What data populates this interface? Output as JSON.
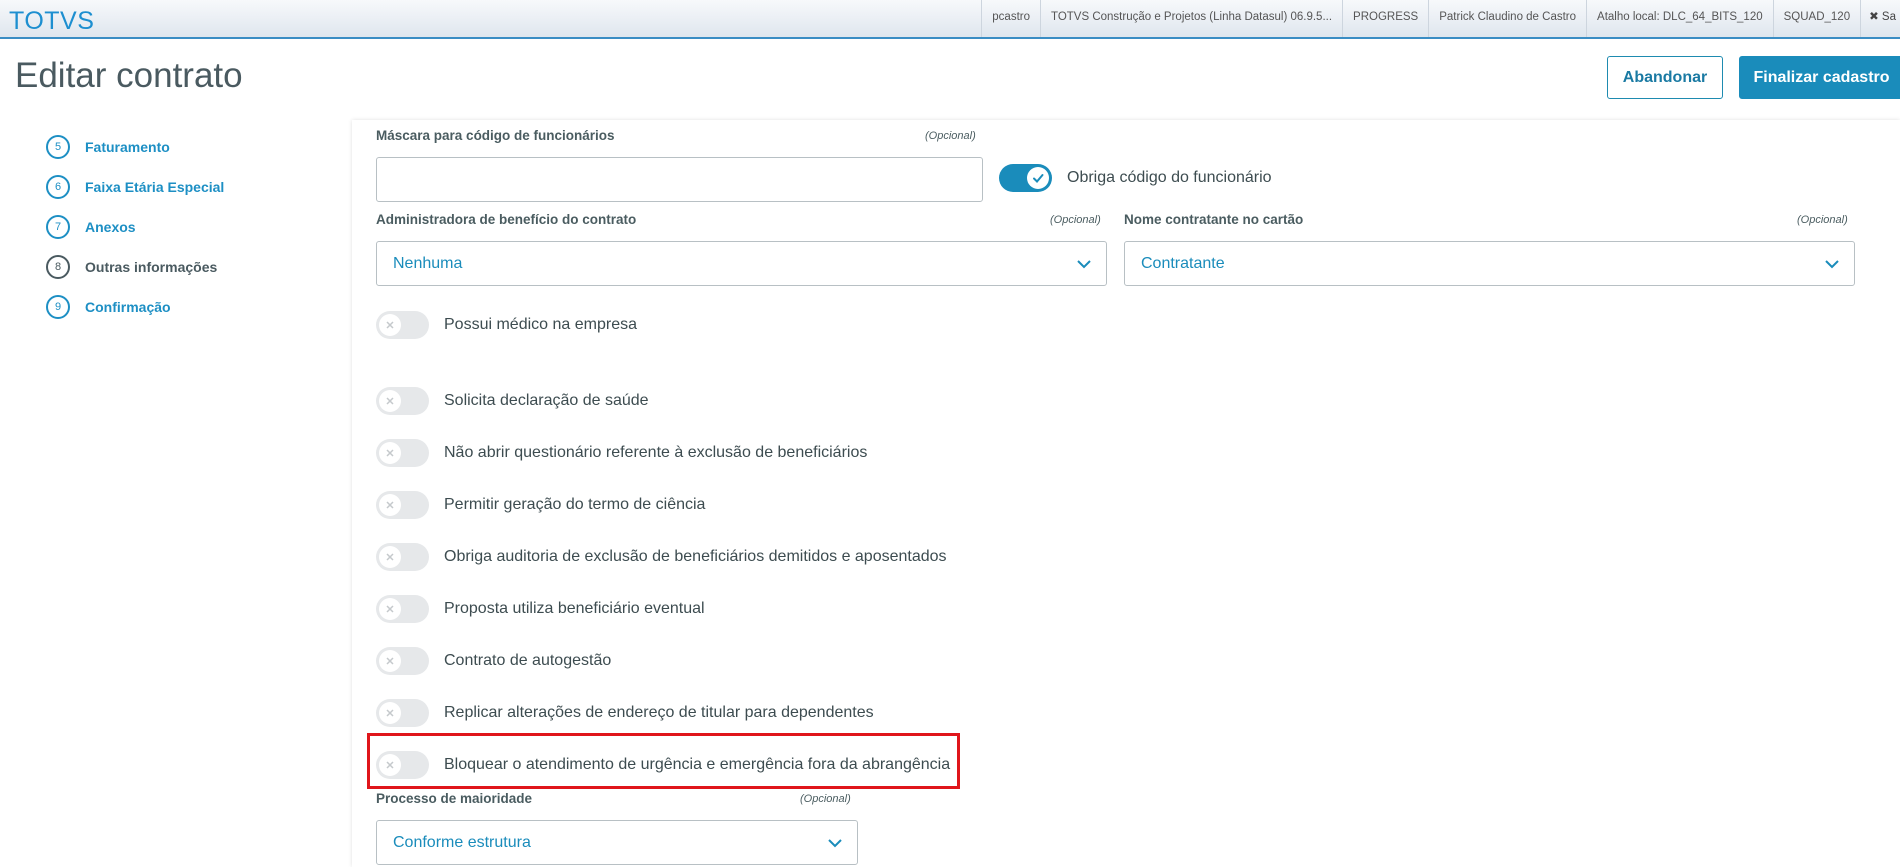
{
  "topbar": {
    "logo": "TOTVS",
    "user": "pcastro",
    "product": "TOTVS Construção e Projetos (Linha Datasul) 06.9.5...",
    "db": "PROGRESS",
    "fullname": "Patrick Claudino de Castro",
    "shortcut": "Atalho local: DLC_64_BITS_120",
    "squad": "SQUAD_120",
    "close": "✖ Sa"
  },
  "header": {
    "title": "Editar contrato",
    "abandon": "Abandonar",
    "finish": "Finalizar cadastro"
  },
  "steps": [
    {
      "num": "5",
      "label": "Faturamento"
    },
    {
      "num": "6",
      "label": "Faixa Etária Especial"
    },
    {
      "num": "7",
      "label": "Anexos"
    },
    {
      "num": "8",
      "label": "Outras informações"
    },
    {
      "num": "9",
      "label": "Confirmação"
    }
  ],
  "form": {
    "mask_label": "Máscara para código de funcionários",
    "mask_optional": "(Opcional)",
    "mask_value": "",
    "require_code": "Obriga código do funcionário",
    "admin_label": "Administradora de benefício do contrato",
    "admin_optional": "(Opcional)",
    "admin_value": "Nenhuma",
    "card_label": "Nome contratante no cartão",
    "card_optional": "(Opcional)",
    "card_value": "Contratante",
    "toggles": [
      "Possui médico na empresa",
      "Solicita declaração de saúde",
      "Não abrir questionário referente à exclusão de beneficiários",
      "Permitir geração do termo de ciência",
      "Obriga auditoria de exclusão de beneficiários demitidos e aposentados",
      "Proposta utiliza beneficiário eventual",
      "Contrato de autogestão",
      "Replicar alterações de endereço de titular para dependentes",
      "Bloquear o atendimento de urgência e emergência fora da abrangência"
    ],
    "majority_label": "Processo de maioridade",
    "majority_optional": "(Opcional)",
    "majority_value": "Conforme estrutura"
  },
  "colors": {
    "accent": "#1a8cbb",
    "highlight": "#e0161b"
  }
}
